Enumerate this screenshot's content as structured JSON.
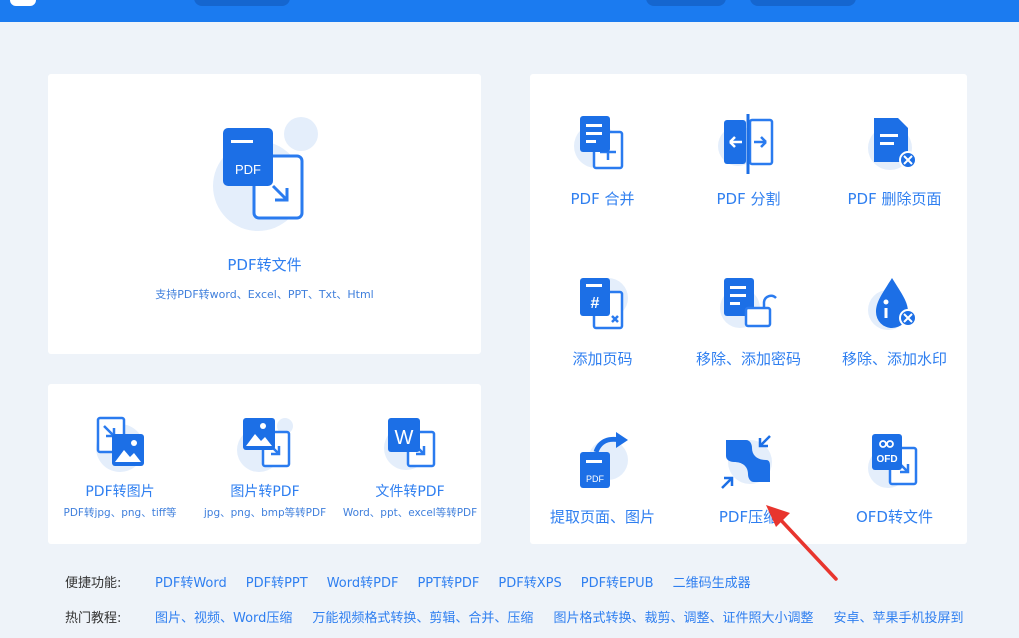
{
  "hero": {
    "title": "PDF转文件",
    "subtitle": "支持PDF转word、Excel、PPT、Txt、Html",
    "icon_text": "PDF"
  },
  "converters": [
    {
      "title": "PDF转图片",
      "subtitle": "PDF转jpg、png、tiff等",
      "icon": "pdf-to-image-icon"
    },
    {
      "title": "图片转PDF",
      "subtitle": "jpg、png、bmp等转PDF",
      "icon": "image-to-pdf-icon"
    },
    {
      "title": "文件转PDF",
      "subtitle": "Word、ppt、excel等转PDF",
      "icon": "file-to-pdf-icon",
      "icon_text": "W"
    }
  ],
  "tools": [
    {
      "title": "PDF 合并",
      "icon": "pdf-merge-icon"
    },
    {
      "title": "PDF 分割",
      "icon": "pdf-split-icon"
    },
    {
      "title": "PDF 删除页面",
      "icon": "pdf-delete-page-icon"
    },
    {
      "title": "添加页码",
      "icon": "add-page-number-icon",
      "icon_text": "#"
    },
    {
      "title": "移除、添加密码",
      "icon": "password-icon"
    },
    {
      "title": "移除、添加水印",
      "icon": "watermark-icon"
    },
    {
      "title": "提取页面、图片",
      "icon": "extract-pages-icon",
      "icon_text": "PDF"
    },
    {
      "title": "PDF压缩",
      "icon": "pdf-compress-icon"
    },
    {
      "title": "OFD转文件",
      "icon": "ofd-convert-icon",
      "icon_text": "OFD"
    }
  ],
  "quick_links": {
    "label": "便捷功能:",
    "items": [
      "PDF转Word",
      "PDF转PPT",
      "Word转PDF",
      "PPT转PDF",
      "PDF转XPS",
      "PDF转EPUB",
      "二维码生成器"
    ]
  },
  "hot_tutorials": {
    "label": "热门教程:",
    "items": [
      "图片、视频、Word压缩",
      "万能视频格式转换、剪辑、合并、压缩",
      "图片格式转换、裁剪、调整、证件照大小调整",
      "安卓、苹果手机投屏到"
    ]
  },
  "colors": {
    "accent": "#2f7ff0",
    "topbar": "#1b7bf0",
    "icon_dark": "#1c6fe6",
    "icon_light": "#e4eefb",
    "annotation_arrow": "#e8352e"
  }
}
